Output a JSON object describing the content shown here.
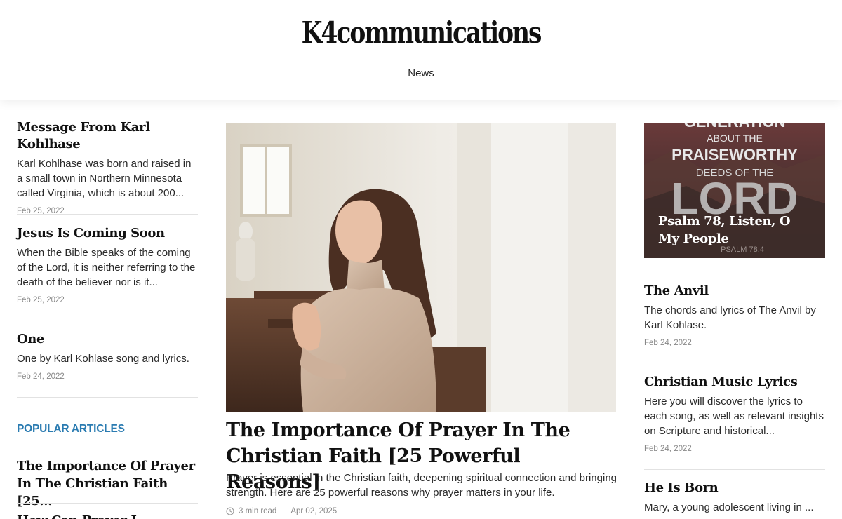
{
  "site": {
    "logo": "K4communications",
    "nav": [
      {
        "label": "News"
      }
    ]
  },
  "left_articles": [
    {
      "title": "Message From Karl Kohlhase",
      "excerpt": "Karl Kohlhase was born and raised in a small town in Northern Minnesota called Virginia, which is about 200...",
      "date": "Feb 25, 2022"
    },
    {
      "title": "Jesus Is Coming Soon",
      "excerpt": "When the Bible speaks of the coming of the Lord, it is neither referring to the death of the believer nor is it...",
      "date": "Feb 25, 2022"
    },
    {
      "title": "One",
      "excerpt": "One by Karl Kohlase song and lyrics.",
      "date": "Feb 24, 2022"
    }
  ],
  "popular": {
    "heading": "POPULAR ARTICLES",
    "items": [
      {
        "title": "The Importance Of Prayer In The Christian Faith [25..."
      },
      {
        "title": "How Can Prayer I..."
      }
    ]
  },
  "featured": {
    "title": "The Importance Of Prayer In The Christian Faith [25 Powerful Reasons]",
    "excerpt": "Prayer is essential in the Christian faith, deepening spiritual connection and bringing strength. Here are 25 powerful reasons why prayer matters in your life.",
    "read_time": "3 min read",
    "date": "Apr 02, 2025"
  },
  "right_card": {
    "title": "Psalm 78, Listen, O My People",
    "image_text": [
      "GENERATION",
      "ABOUT THE",
      "PRAISEWORTHY",
      "DEEDS OF THE",
      "LORD",
      "PSALM 78:4"
    ]
  },
  "right_articles": [
    {
      "title": "The Anvil",
      "excerpt": "The chords and lyrics of The Anvil by Karl Kohlase.",
      "date": "Feb 24, 2022"
    },
    {
      "title": "Christian Music Lyrics",
      "excerpt": "Here you will discover the lyrics to each song, as well as relevant insights on Scripture and historical...",
      "date": "Feb 24, 2022"
    },
    {
      "title": "He Is Born",
      "excerpt": "Mary, a young adolescent living in ..."
    }
  ],
  "colors": {
    "accent": "#2a7bb1",
    "text": "#111111",
    "muted": "#888888"
  },
  "icons": {
    "read_time": "clock-icon"
  }
}
